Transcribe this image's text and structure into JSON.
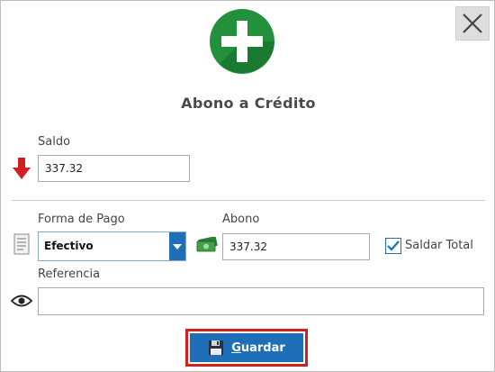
{
  "dialog": {
    "title": "Abono a Crédito",
    "close_icon": "close-icon",
    "logo_icon": "plus-circle-icon"
  },
  "saldo": {
    "label": "Saldo",
    "value": "337.32",
    "icon": "down-arrow-icon"
  },
  "forma_pago": {
    "label": "Forma de Pago",
    "selected": "Efectivo",
    "icon": "document-icon"
  },
  "abono": {
    "label": "Abono",
    "value": "337.32",
    "icon": "money-icon"
  },
  "saldar_total": {
    "label": "Saldar Total",
    "checked": true
  },
  "referencia": {
    "label": "Referencia",
    "value": "",
    "icon": "eye-icon"
  },
  "save_button": {
    "first_letter": "G",
    "rest": "uardar",
    "icon": "floppy-disk-icon"
  },
  "colors": {
    "accent": "#1f6fb8",
    "logo_green": "#23913c",
    "arrow_red": "#d11f1f",
    "save_border": "#d11f1f"
  }
}
